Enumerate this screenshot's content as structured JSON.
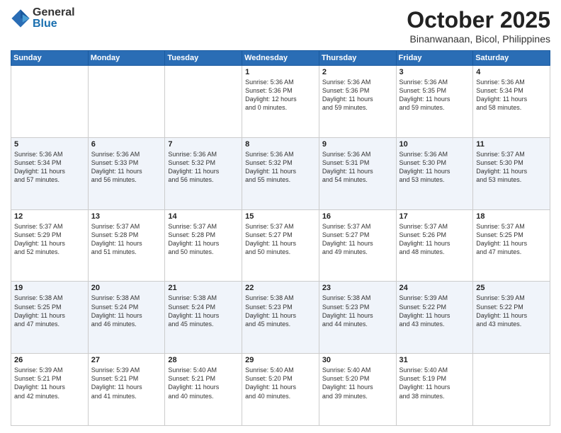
{
  "logo": {
    "general": "General",
    "blue": "Blue"
  },
  "title": "October 2025",
  "subtitle": "Binanwanaan, Bicol, Philippines",
  "days_of_week": [
    "Sunday",
    "Monday",
    "Tuesday",
    "Wednesday",
    "Thursday",
    "Friday",
    "Saturday"
  ],
  "weeks": [
    [
      {
        "num": "",
        "info": ""
      },
      {
        "num": "",
        "info": ""
      },
      {
        "num": "",
        "info": ""
      },
      {
        "num": "1",
        "info": "Sunrise: 5:36 AM\nSunset: 5:36 PM\nDaylight: 12 hours\nand 0 minutes."
      },
      {
        "num": "2",
        "info": "Sunrise: 5:36 AM\nSunset: 5:36 PM\nDaylight: 11 hours\nand 59 minutes."
      },
      {
        "num": "3",
        "info": "Sunrise: 5:36 AM\nSunset: 5:35 PM\nDaylight: 11 hours\nand 59 minutes."
      },
      {
        "num": "4",
        "info": "Sunrise: 5:36 AM\nSunset: 5:34 PM\nDaylight: 11 hours\nand 58 minutes."
      }
    ],
    [
      {
        "num": "5",
        "info": "Sunrise: 5:36 AM\nSunset: 5:34 PM\nDaylight: 11 hours\nand 57 minutes."
      },
      {
        "num": "6",
        "info": "Sunrise: 5:36 AM\nSunset: 5:33 PM\nDaylight: 11 hours\nand 56 minutes."
      },
      {
        "num": "7",
        "info": "Sunrise: 5:36 AM\nSunset: 5:32 PM\nDaylight: 11 hours\nand 56 minutes."
      },
      {
        "num": "8",
        "info": "Sunrise: 5:36 AM\nSunset: 5:32 PM\nDaylight: 11 hours\nand 55 minutes."
      },
      {
        "num": "9",
        "info": "Sunrise: 5:36 AM\nSunset: 5:31 PM\nDaylight: 11 hours\nand 54 minutes."
      },
      {
        "num": "10",
        "info": "Sunrise: 5:36 AM\nSunset: 5:30 PM\nDaylight: 11 hours\nand 53 minutes."
      },
      {
        "num": "11",
        "info": "Sunrise: 5:37 AM\nSunset: 5:30 PM\nDaylight: 11 hours\nand 53 minutes."
      }
    ],
    [
      {
        "num": "12",
        "info": "Sunrise: 5:37 AM\nSunset: 5:29 PM\nDaylight: 11 hours\nand 52 minutes."
      },
      {
        "num": "13",
        "info": "Sunrise: 5:37 AM\nSunset: 5:28 PM\nDaylight: 11 hours\nand 51 minutes."
      },
      {
        "num": "14",
        "info": "Sunrise: 5:37 AM\nSunset: 5:28 PM\nDaylight: 11 hours\nand 50 minutes."
      },
      {
        "num": "15",
        "info": "Sunrise: 5:37 AM\nSunset: 5:27 PM\nDaylight: 11 hours\nand 50 minutes."
      },
      {
        "num": "16",
        "info": "Sunrise: 5:37 AM\nSunset: 5:27 PM\nDaylight: 11 hours\nand 49 minutes."
      },
      {
        "num": "17",
        "info": "Sunrise: 5:37 AM\nSunset: 5:26 PM\nDaylight: 11 hours\nand 48 minutes."
      },
      {
        "num": "18",
        "info": "Sunrise: 5:37 AM\nSunset: 5:25 PM\nDaylight: 11 hours\nand 47 minutes."
      }
    ],
    [
      {
        "num": "19",
        "info": "Sunrise: 5:38 AM\nSunset: 5:25 PM\nDaylight: 11 hours\nand 47 minutes."
      },
      {
        "num": "20",
        "info": "Sunrise: 5:38 AM\nSunset: 5:24 PM\nDaylight: 11 hours\nand 46 minutes."
      },
      {
        "num": "21",
        "info": "Sunrise: 5:38 AM\nSunset: 5:24 PM\nDaylight: 11 hours\nand 45 minutes."
      },
      {
        "num": "22",
        "info": "Sunrise: 5:38 AM\nSunset: 5:23 PM\nDaylight: 11 hours\nand 45 minutes."
      },
      {
        "num": "23",
        "info": "Sunrise: 5:38 AM\nSunset: 5:23 PM\nDaylight: 11 hours\nand 44 minutes."
      },
      {
        "num": "24",
        "info": "Sunrise: 5:39 AM\nSunset: 5:22 PM\nDaylight: 11 hours\nand 43 minutes."
      },
      {
        "num": "25",
        "info": "Sunrise: 5:39 AM\nSunset: 5:22 PM\nDaylight: 11 hours\nand 43 minutes."
      }
    ],
    [
      {
        "num": "26",
        "info": "Sunrise: 5:39 AM\nSunset: 5:21 PM\nDaylight: 11 hours\nand 42 minutes."
      },
      {
        "num": "27",
        "info": "Sunrise: 5:39 AM\nSunset: 5:21 PM\nDaylight: 11 hours\nand 41 minutes."
      },
      {
        "num": "28",
        "info": "Sunrise: 5:40 AM\nSunset: 5:21 PM\nDaylight: 11 hours\nand 40 minutes."
      },
      {
        "num": "29",
        "info": "Sunrise: 5:40 AM\nSunset: 5:20 PM\nDaylight: 11 hours\nand 40 minutes."
      },
      {
        "num": "30",
        "info": "Sunrise: 5:40 AM\nSunset: 5:20 PM\nDaylight: 11 hours\nand 39 minutes."
      },
      {
        "num": "31",
        "info": "Sunrise: 5:40 AM\nSunset: 5:19 PM\nDaylight: 11 hours\nand 38 minutes."
      },
      {
        "num": "",
        "info": ""
      }
    ]
  ]
}
